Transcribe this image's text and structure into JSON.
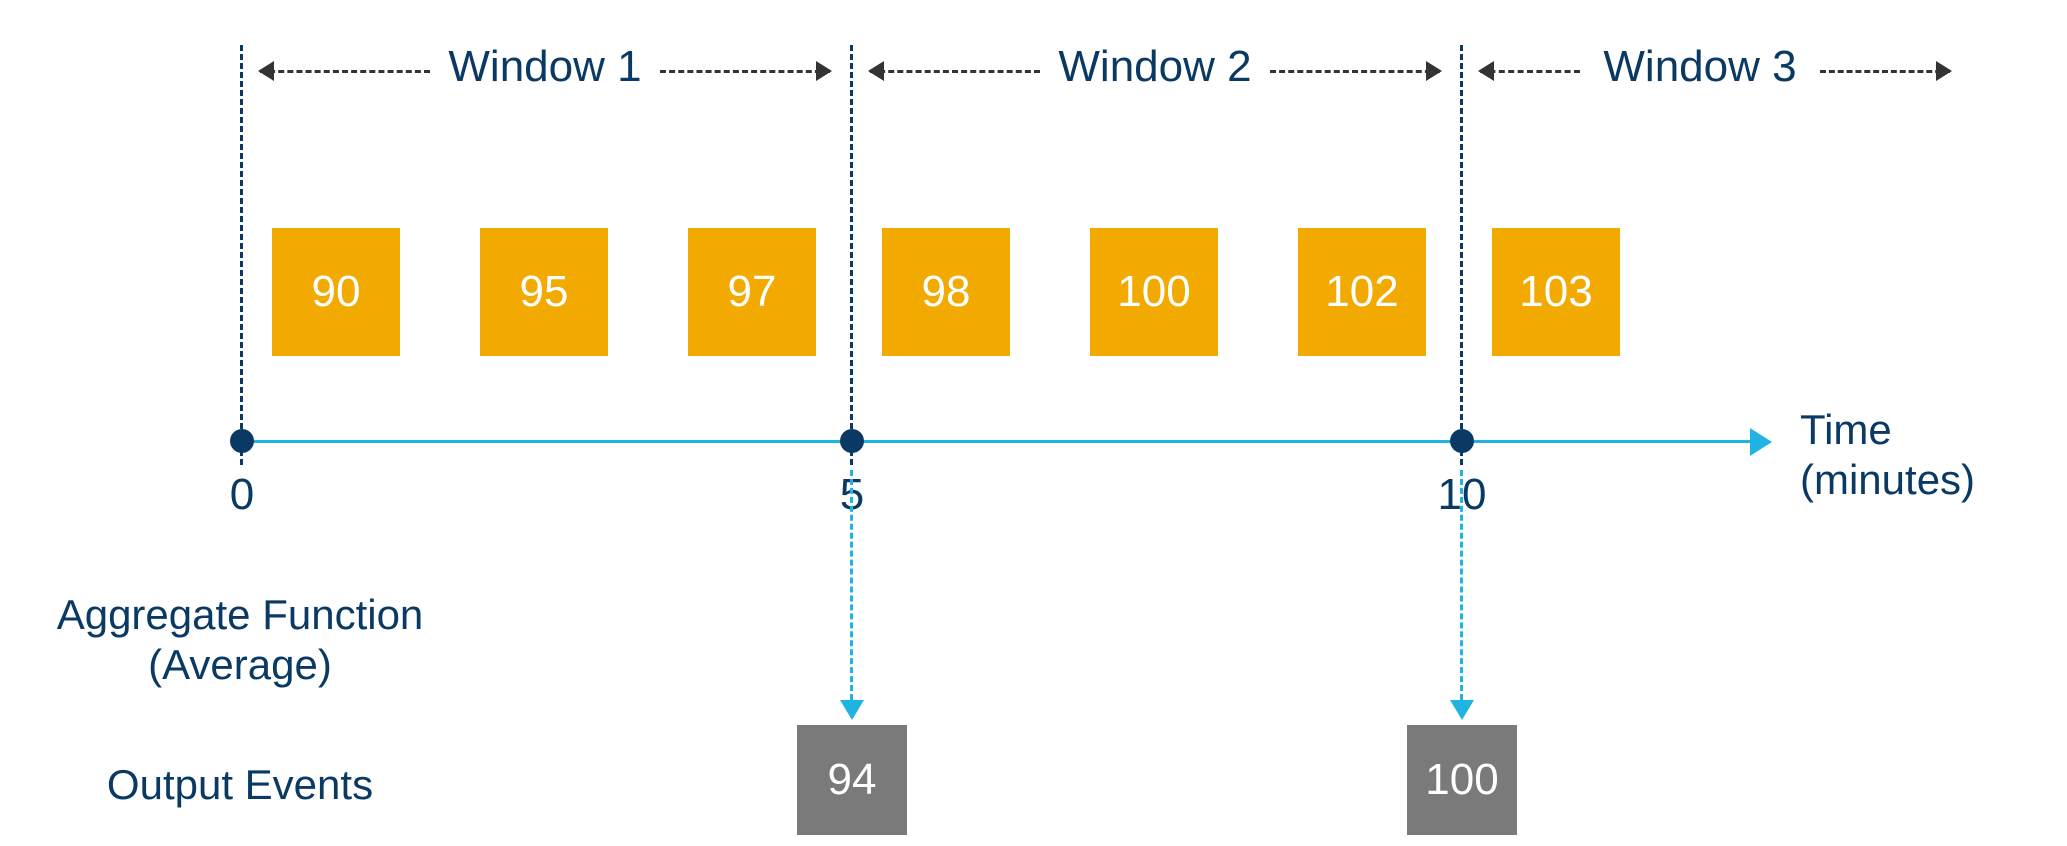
{
  "diagram": {
    "windows": [
      {
        "label": "Window 1"
      },
      {
        "label": "Window 2"
      },
      {
        "label": "Window 3"
      }
    ],
    "events": [
      {
        "value": "90"
      },
      {
        "value": "95"
      },
      {
        "value": "97"
      },
      {
        "value": "98"
      },
      {
        "value": "100"
      },
      {
        "value": "102"
      },
      {
        "value": "103"
      }
    ],
    "ticks": [
      {
        "label": "0"
      },
      {
        "label": "5"
      },
      {
        "label": "10"
      }
    ],
    "axis_label_1": "Time",
    "axis_label_2": "(minutes)",
    "aggregate_label_1": "Aggregate Function",
    "aggregate_label_2": "(Average)",
    "output_label": "Output Events",
    "outputs": [
      {
        "value": "94"
      },
      {
        "value": "100"
      }
    ]
  }
}
